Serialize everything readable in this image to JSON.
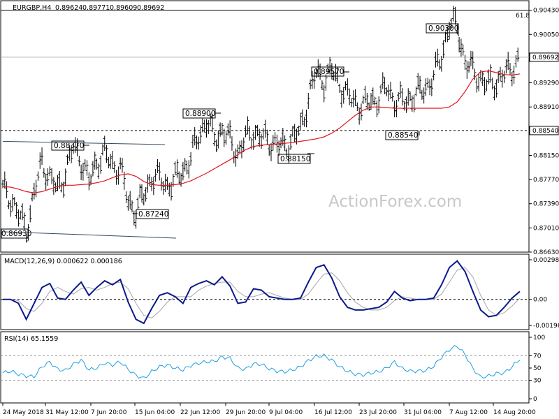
{
  "chart_data": [
    {
      "type": "ohlc",
      "header": {
        "symbol": "EURGBP,H4",
        "open": "0.89624",
        "high": "0.89771",
        "low": "0.89609",
        "close": "0.89692"
      },
      "ylim": [
        0.8663,
        0.9058
      ],
      "yticks": [
        "0.90430",
        "0.90050",
        "0.89692",
        "0.89290",
        "0.88910",
        "0.88540",
        "0.88150",
        "0.87770",
        "0.87390",
        "0.87010",
        "0.86630"
      ],
      "last_price": "0.89692",
      "support_level": "0.88540",
      "fib_label": "61.8",
      "fib_level": 0.9043,
      "watermark": "ActionForex.com",
      "ma_series": [
        0.8766,
        0.8765,
        0.8762,
        0.8758,
        0.8756,
        0.8758,
        0.8762,
        0.8766,
        0.8768,
        0.8768,
        0.8769,
        0.877,
        0.8772,
        0.8775,
        0.878,
        0.8784,
        0.8786,
        0.8782,
        0.8774,
        0.8769,
        0.8768,
        0.8768,
        0.8769,
        0.8771,
        0.8775,
        0.8781,
        0.8787,
        0.8794,
        0.8801,
        0.8808,
        0.8816,
        0.8824,
        0.8829,
        0.8831,
        0.8832,
        0.8833,
        0.8834,
        0.8835,
        0.8837,
        0.8839,
        0.8841,
        0.8844,
        0.885,
        0.8858,
        0.8868,
        0.8878,
        0.8886,
        0.8891,
        0.8891,
        0.889,
        0.8889,
        0.8889,
        0.8889,
        0.8889,
        0.8889,
        0.8889,
        0.8889,
        0.8891,
        0.8899,
        0.8915,
        0.8935,
        0.8946,
        0.8948,
        0.8945,
        0.8942,
        0.8941,
        0.8943
      ],
      "annotations": [
        "0.90300",
        "0.89570",
        "0.88900",
        "0.88370",
        "0.88150",
        "0.88540",
        "0.87240",
        "0.86930"
      ],
      "x_ticks": [
        "24 May 2018",
        "31 May 12:00",
        "7 Jun 20:00",
        "15 Jun 04:00",
        "22 Jun 12:00",
        "29 Jun 20:00",
        "9 Jul 04:00",
        "16 Jul 12:00",
        "23 Jul 20:00",
        "31 Jul 04:00",
        "7 Aug 12:00",
        "14 Aug 20:00"
      ]
    },
    {
      "type": "line",
      "title": "MACD(12,26,9) 0.000622 0.000186",
      "ylim": [
        -0.00196,
        0.002984
      ],
      "yticks": [
        "0.002984",
        "0.00",
        "-0.00196"
      ],
      "macd": [
        0.0,
        0.0,
        -0.0003,
        -0.0015,
        -0.0003,
        0.0009,
        0.0012,
        0.0001,
        0.0,
        0.0007,
        0.0013,
        0.0003,
        0.0009,
        0.0014,
        0.0011,
        0.0015,
        -0.0002,
        -0.0015,
        -0.0018,
        -0.0007,
        0.0003,
        0.0005,
        0.0002,
        -0.0003,
        0.0009,
        0.0012,
        0.0014,
        0.0011,
        0.0017,
        0.001,
        -0.0003,
        -0.0002,
        0.0008,
        0.0007,
        0.0002,
        0.0001,
        0.0,
        0.0,
        0.0001,
        0.0013,
        0.0024,
        0.0026,
        0.0016,
        0.0002,
        -0.0006,
        -0.0008,
        -0.0008,
        -0.0007,
        -0.0006,
        -0.0002,
        0.0006,
        0.0001,
        -0.0001,
        0.0,
        0.0,
        0.0001,
        0.0011,
        0.0024,
        0.0029,
        0.0021,
        0.0006,
        -0.0008,
        -0.0013,
        -0.0012,
        -0.0006,
        0.0001,
        0.0006
      ],
      "signal": [
        0.0,
        0.0,
        -0.0001,
        -0.0007,
        -0.0009,
        -0.0003,
        0.0006,
        0.0009,
        0.0006,
        0.0004,
        0.0008,
        0.0009,
        0.0007,
        0.0009,
        0.0012,
        0.0013,
        0.0008,
        -0.0003,
        -0.0012,
        -0.0014,
        -0.0009,
        -0.0002,
        0.0002,
        0.0002,
        0.0002,
        0.0007,
        0.001,
        0.0012,
        0.0013,
        0.0013,
        0.0006,
        0.0002,
        0.0002,
        0.0004,
        0.0005,
        0.0003,
        0.0001,
        0.0,
        0.0,
        0.0004,
        0.0012,
        0.0019,
        0.002,
        0.0014,
        0.0005,
        -0.0002,
        -0.0006,
        -0.0008,
        -0.0008,
        -0.0006,
        -0.0001,
        0.0002,
        0.0001,
        0.0,
        0.0,
        0.0,
        0.0004,
        0.0013,
        0.0022,
        0.0024,
        0.0017,
        0.0003,
        -0.0008,
        -0.0012,
        -0.001,
        -0.0005,
        0.0001
      ]
    },
    {
      "type": "line",
      "title": "RSI(14) 65.1559",
      "ylim": [
        0,
        100
      ],
      "yticks": [
        "100",
        "70",
        "50",
        "30",
        "0"
      ],
      "levels": [
        70,
        30
      ],
      "rsi": [
        42,
        45,
        40,
        37,
        36,
        52,
        60,
        48,
        46,
        56,
        63,
        47,
        50,
        58,
        55,
        60,
        48,
        38,
        33,
        44,
        52,
        55,
        50,
        47,
        54,
        58,
        60,
        61,
        68,
        66,
        50,
        48,
        57,
        56,
        49,
        45,
        44,
        47,
        52,
        62,
        69,
        70,
        63,
        52,
        45,
        40,
        39,
        42,
        44,
        50,
        60,
        49,
        45,
        45,
        46,
        53,
        68,
        80,
        86,
        72,
        49,
        35,
        37,
        41,
        42,
        52,
        65
      ]
    }
  ]
}
